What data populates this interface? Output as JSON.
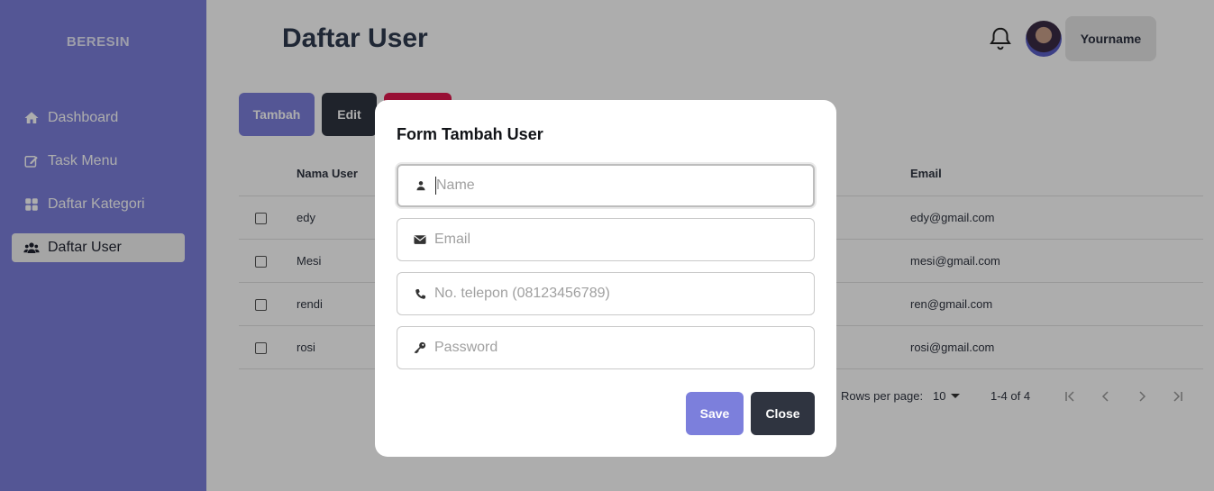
{
  "app": {
    "brand": "BERESIN"
  },
  "sidebar": {
    "items": [
      {
        "label": "Dashboard",
        "icon": "home-icon"
      },
      {
        "label": "Task Menu",
        "icon": "edit-square-icon"
      },
      {
        "label": "Daftar Kategori",
        "icon": "grid-icon"
      },
      {
        "label": "Daftar User",
        "icon": "users-icon",
        "active": true
      }
    ]
  },
  "header": {
    "title": "Daftar User",
    "username": "Yourname",
    "bell_icon": "bell-icon",
    "avatar_icon": "avatar"
  },
  "toolbar": {
    "tambah_label": "Tambah",
    "edit_label": "Edit",
    "hapus_label": ""
  },
  "table": {
    "columns": {
      "name": "Nama User",
      "email": "Email"
    },
    "rows": [
      {
        "name": "edy",
        "email": "edy@gmail.com"
      },
      {
        "name": "Mesi",
        "email": "mesi@gmail.com"
      },
      {
        "name": "rendi",
        "email": "ren@gmail.com"
      },
      {
        "name": "rosi",
        "email": "rosi@gmail.com"
      }
    ]
  },
  "pagination": {
    "rows_per_page_label": "Rows per page:",
    "rows_per_page_value": "10",
    "range": "1-4 of 4"
  },
  "modal": {
    "title": "Form Tambah User",
    "fields": [
      {
        "placeholder": "Name",
        "value": "",
        "icon": "person-icon"
      },
      {
        "placeholder": "Email",
        "value": "",
        "icon": "envelope-icon"
      },
      {
        "placeholder": "No. telepon (08123456789)",
        "value": "",
        "icon": "phone-icon"
      },
      {
        "placeholder": "Password",
        "value": "",
        "icon": "key-icon"
      }
    ],
    "save_label": "Save",
    "close_label": "Close"
  },
  "colors": {
    "accent": "#7c7fdc",
    "dark": "#2f3440",
    "danger": "#e0194f"
  }
}
